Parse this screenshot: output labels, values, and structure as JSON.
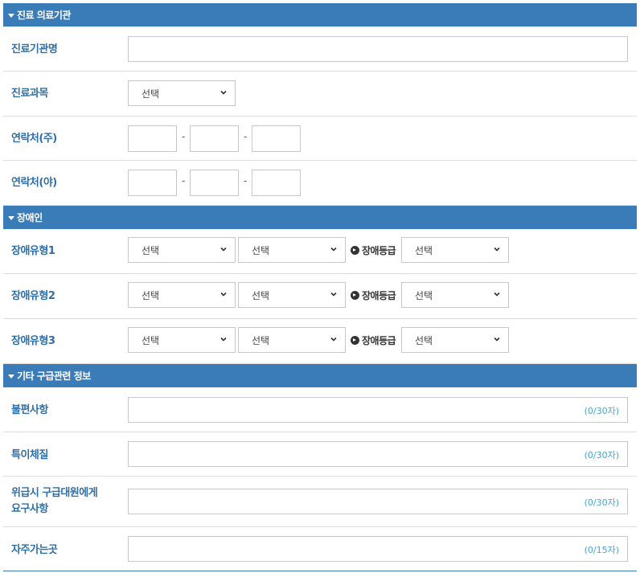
{
  "sections": {
    "medical": {
      "title": "진료 의료기관"
    },
    "disability": {
      "title": "장애인"
    },
    "other": {
      "title": "기타 구급관련 정보"
    }
  },
  "medical": {
    "institution_label": "진료기관명",
    "department_label": "진료과목",
    "department_select": "선택",
    "phone_day_label": "연락처(주)",
    "phone_night_label": "연락처(야)",
    "dash": "-"
  },
  "disability": {
    "grade_label": "장애등급",
    "rows": [
      {
        "label": "장애유형1",
        "select1": "선택",
        "select2": "선택",
        "grade": "선택"
      },
      {
        "label": "장애유형2",
        "select1": "선택",
        "select2": "선택",
        "grade": "선택"
      },
      {
        "label": "장애유형3",
        "select1": "선택",
        "select2": "선택",
        "grade": "선택"
      }
    ]
  },
  "other": {
    "fields": [
      {
        "label": "불편사항",
        "counter": "(0/30자)"
      },
      {
        "label": "특이체질",
        "counter": "(0/30자)"
      },
      {
        "label_line1": "위급시 구급대원에게",
        "label_line2": "요구사항",
        "counter": "(0/30자)"
      },
      {
        "label": "자주가는곳",
        "counter": "(0/15자)"
      }
    ]
  },
  "colors": {
    "header": "#3a7cb8",
    "label": "#2f6fa8",
    "counter": "#4aa3d8"
  }
}
